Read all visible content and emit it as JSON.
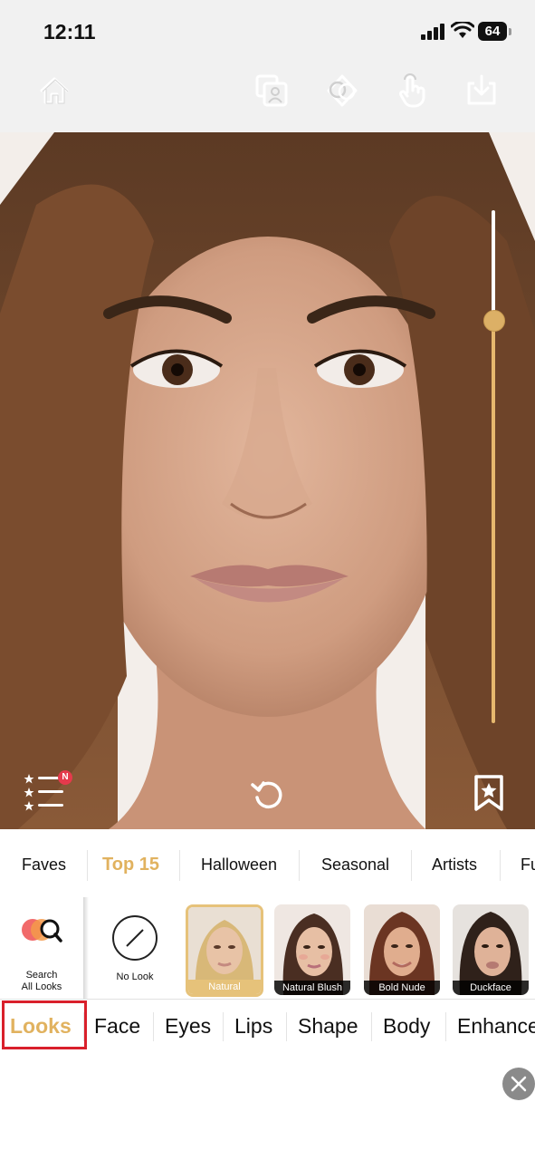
{
  "status_bar": {
    "time": "12:11",
    "battery": "64"
  },
  "toolbar": {
    "icons": [
      "home-icon",
      "photo-compare-icon",
      "face-swap-icon",
      "touch-icon",
      "download-icon"
    ]
  },
  "photo": {
    "alt": "face preview",
    "intensity_slider": 0.79,
    "icons": [
      "look-list-icon",
      "undo-icon",
      "bookmark-icon"
    ],
    "new_badge": "N"
  },
  "categories": [
    "Faves",
    "Top 15",
    "Halloween",
    "Seasonal",
    "Artists",
    "Fu"
  ],
  "active_category": "Top 15",
  "looks": {
    "search_label_line1": "Search",
    "search_label_line2": "All Looks",
    "no_look_label": "No Look",
    "items": [
      {
        "label": "Natural",
        "selected": true
      },
      {
        "label": "Natural Blush",
        "selected": false
      },
      {
        "label": "Bold Nude",
        "selected": false
      },
      {
        "label": "Duckface",
        "selected": false
      }
    ]
  },
  "tabs": [
    "Looks",
    "Face",
    "Eyes",
    "Lips",
    "Shape",
    "Body",
    "Enhance"
  ],
  "active_tab": "Looks",
  "colors": {
    "accent": "#e1b25f",
    "highlight_box": "#d9202b"
  }
}
